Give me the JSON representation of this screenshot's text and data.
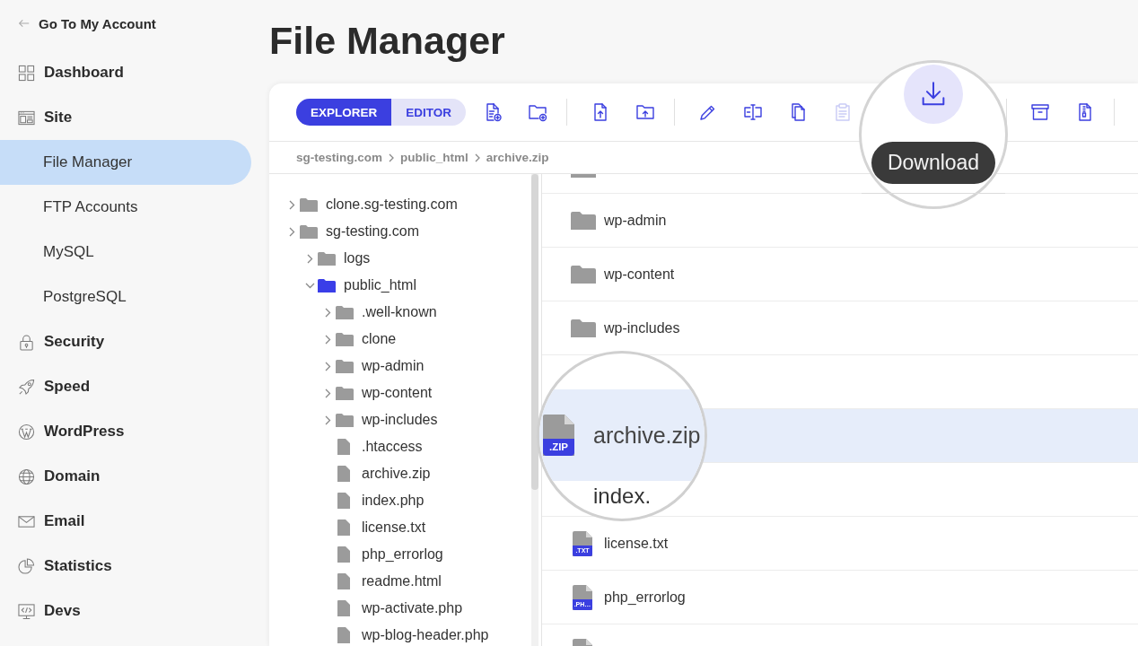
{
  "sidebar": {
    "back_link": "Go To My Account",
    "items": [
      {
        "label": "Dashboard",
        "kind": "dashboard",
        "selected": false
      },
      {
        "label": "Site",
        "kind": "site",
        "selected": false,
        "children": [
          {
            "label": "File Manager",
            "selected": true
          },
          {
            "label": "FTP Accounts",
            "selected": false
          },
          {
            "label": "MySQL",
            "selected": false
          },
          {
            "label": "PostgreSQL",
            "selected": false
          }
        ]
      },
      {
        "label": "Security",
        "kind": "security",
        "selected": false
      },
      {
        "label": "Speed",
        "kind": "speed",
        "selected": false
      },
      {
        "label": "WordPress",
        "kind": "wordpress",
        "selected": false
      },
      {
        "label": "Domain",
        "kind": "domain",
        "selected": false
      },
      {
        "label": "Email",
        "kind": "email",
        "selected": false
      },
      {
        "label": "Statistics",
        "kind": "statistics",
        "selected": false
      },
      {
        "label": "Devs",
        "kind": "devs",
        "selected": false
      }
    ]
  },
  "page": {
    "title": "File Manager"
  },
  "toolbar": {
    "modes": [
      {
        "label": "EXPLORER",
        "selected": true
      },
      {
        "label": "EDITOR",
        "selected": false
      }
    ],
    "groups": [
      {
        "buttons": [
          {
            "kind": "newfile",
            "disabled": false
          },
          {
            "kind": "newfolder",
            "disabled": false
          }
        ]
      },
      {
        "buttons": [
          {
            "kind": "upload",
            "disabled": false
          },
          {
            "kind": "uploadfolder",
            "disabled": false
          }
        ]
      },
      {
        "buttons": [
          {
            "kind": "edit",
            "disabled": false
          },
          {
            "kind": "rename",
            "disabled": false
          },
          {
            "kind": "copy",
            "disabled": false
          },
          {
            "kind": "paste",
            "disabled": true
          }
        ],
        "magnifier": {
          "kind": "download",
          "hovered": true,
          "tooltip": "Download"
        }
      },
      {
        "buttons": [
          {
            "kind": "archive",
            "disabled": false
          },
          {
            "kind": "extract",
            "disabled": false
          }
        ]
      }
    ]
  },
  "breadcrumb": [
    "sg-testing.com",
    "public_html",
    "archive.zip"
  ],
  "tree": {
    "nodes": [
      {
        "name": "clone.sg-testing.com",
        "kind": "folder",
        "expanded": false
      },
      {
        "name": "sg-testing.com",
        "kind": "folder",
        "expanded": false,
        "children": [
          {
            "name": "logs",
            "kind": "folder",
            "expanded": false
          },
          {
            "name": "public_html",
            "kind": "folder",
            "expanded": true,
            "children": [
              {
                "name": ".well-known",
                "kind": "folder",
                "expanded": false
              },
              {
                "name": "clone",
                "kind": "folder",
                "expanded": false
              },
              {
                "name": "wp-admin",
                "kind": "folder",
                "expanded": false
              },
              {
                "name": "wp-content",
                "kind": "folder",
                "expanded": false
              },
              {
                "name": "wp-includes",
                "kind": "folder",
                "expanded": false
              },
              {
                "name": ".htaccess",
                "kind": "file"
              },
              {
                "name": "archive.zip",
                "kind": "file"
              },
              {
                "name": "index.php",
                "kind": "file"
              },
              {
                "name": "license.txt",
                "kind": "file"
              },
              {
                "name": "php_errorlog",
                "kind": "file"
              },
              {
                "name": "readme.html",
                "kind": "file"
              },
              {
                "name": "wp-activate.php",
                "kind": "file"
              },
              {
                "name": "wp-blog-header.php",
                "kind": "file"
              }
            ]
          }
        ]
      }
    ]
  },
  "file_list": {
    "rows": [
      {
        "kind": "folder",
        "selected": false
      },
      {
        "kind": "folder",
        "name": "wp-admin",
        "selected": false
      },
      {
        "kind": "folder",
        "name": "wp-content",
        "selected": false
      },
      {
        "kind": "folder",
        "name": "wp-includes",
        "selected": false
      },
      {
        "kind": "file",
        "ext": ".ZIP",
        "name": "archive.zip",
        "selected": true,
        "under_lens": true
      },
      {
        "name": "index.",
        "selected": false,
        "under_lens": true
      },
      {
        "kind": "file",
        "ext": ".TXT",
        "name": "license.txt",
        "selected": false
      },
      {
        "kind": "file",
        "ext": ".PH…",
        "name": "php_errorlog",
        "selected": false
      },
      {
        "kind": "file",
        "selected": false
      }
    ]
  }
}
